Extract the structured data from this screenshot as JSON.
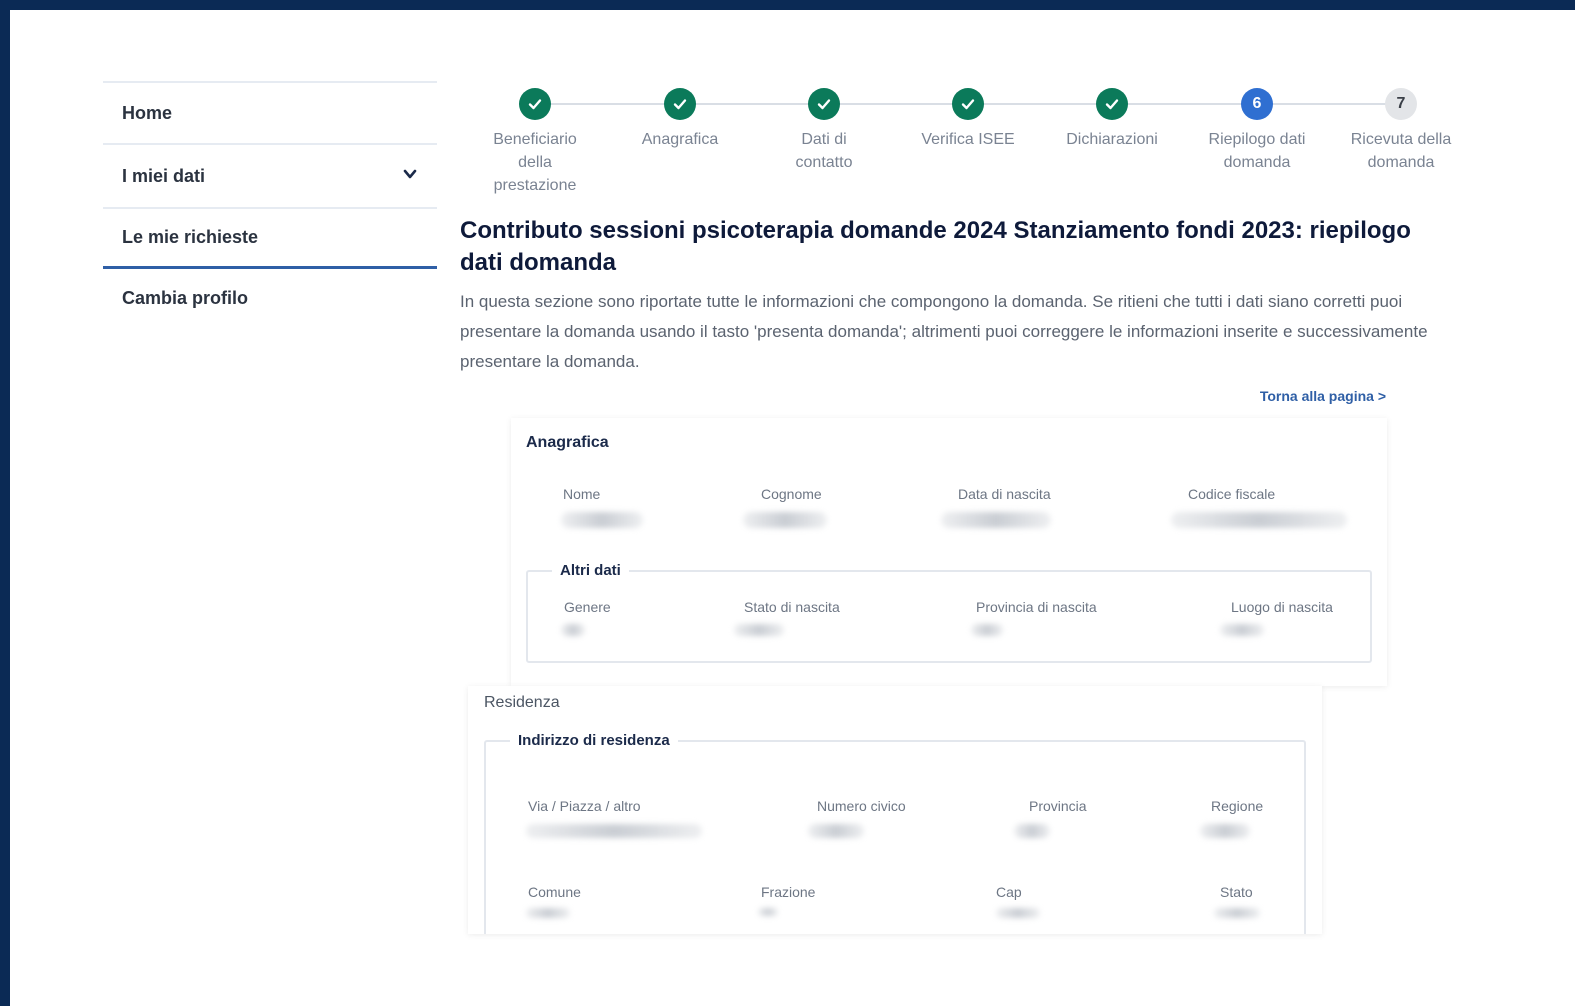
{
  "sidebar": {
    "items": [
      {
        "label": "Home"
      },
      {
        "label": "I miei dati"
      },
      {
        "label": "Le mie richieste"
      },
      {
        "label": "Cambia profilo"
      }
    ]
  },
  "stepper": {
    "steps": [
      {
        "number": "1",
        "label": "Beneficiario della prestazione",
        "status": "done"
      },
      {
        "number": "2",
        "label": "Anagrafica",
        "status": "done"
      },
      {
        "number": "3",
        "label": "Dati di contatto",
        "status": "done"
      },
      {
        "number": "4",
        "label": "Verifica ISEE",
        "status": "done"
      },
      {
        "number": "5",
        "label": "Dichiarazioni",
        "status": "done"
      },
      {
        "number": "6",
        "label": "Riepilogo dati domanda",
        "status": "current"
      },
      {
        "number": "7",
        "label": "Ricevuta della domanda",
        "status": "todo"
      }
    ]
  },
  "main": {
    "title": "Contributo sessioni psicoterapia domande 2024 Stanziamento fondi 2023: riepilogo dati domanda",
    "description": "In questa sezione sono riportate tutte le informazioni che compongono la domanda. Se ritieni che tutti i dati siano corretti puoi presentare la domanda usando il tasto 'presenta domanda'; altrimenti puoi correggere le informazioni inserite e successivamente presentare la domanda.",
    "back_link": "Torna alla pagina >"
  },
  "anagrafica": {
    "title": "Anagrafica",
    "fields": [
      "Nome",
      "Cognome",
      "Data di nascita",
      "Codice fiscale"
    ],
    "altri_dati": {
      "legend": "Altri dati",
      "fields": [
        "Genere",
        "Stato di nascita",
        "Provincia di nascita",
        "Luogo di nascita"
      ]
    }
  },
  "residenza": {
    "title": "Residenza",
    "indirizzo": {
      "legend": "Indirizzo di residenza",
      "row1": [
        "Via / Piazza / altro",
        "Numero civico",
        "Provincia",
        "Regione"
      ],
      "row2": [
        "Comune",
        "Frazione",
        "Cap",
        "Stato"
      ]
    }
  },
  "colors": {
    "done": "#0b7a5a",
    "current": "#2f6fd1",
    "accent": "#2f5fa6",
    "frame": "#0b2a55"
  },
  "icons": {
    "step_done": "check-icon",
    "dropdown": "chevron-down-icon"
  }
}
